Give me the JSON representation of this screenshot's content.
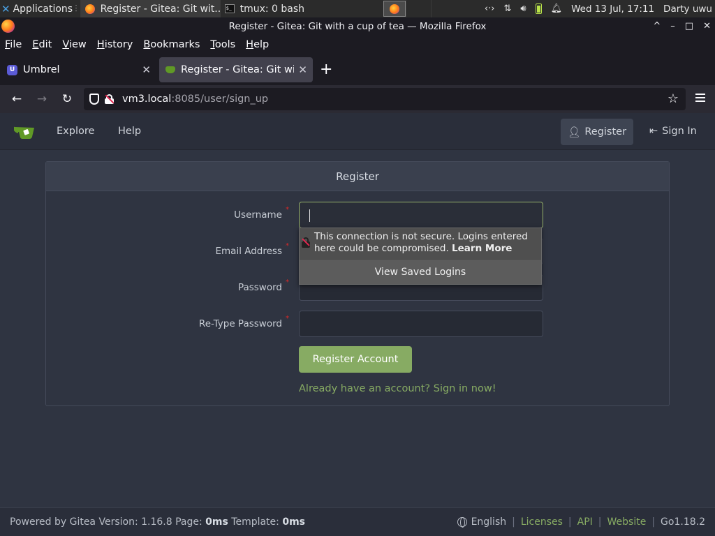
{
  "panel": {
    "applications_label": "Applications",
    "tasks": [
      {
        "label": "Register - Gitea: Git wit..."
      },
      {
        "label": "tmux: 0 bash"
      }
    ],
    "datetime": "Wed 13 Jul, 17:11",
    "user": "Darty uwu"
  },
  "window": {
    "title": "Register - Gitea: Git with a cup of tea — Mozilla Firefox",
    "controls": {
      "max": "^",
      "min": "–",
      "restore": "□",
      "close": "✕"
    }
  },
  "menubar": [
    "File",
    "Edit",
    "View",
    "History",
    "Bookmarks",
    "Tools",
    "Help"
  ],
  "tabs": [
    {
      "title": "Umbrel",
      "favicon": "umbrel-icon"
    },
    {
      "title": "Register - Gitea: Git with a cup of tea",
      "favicon": "gitea-icon",
      "selected": true
    }
  ],
  "urlbar": {
    "host": "vm3.local",
    "rest": ":8085/user/sign_up"
  },
  "gitea": {
    "nav": {
      "explore": "Explore",
      "help": "Help",
      "register": "Register",
      "sign_in": "Sign In"
    },
    "form": {
      "header": "Register",
      "fields": [
        {
          "label": "Username",
          "value": ""
        },
        {
          "label": "Email Address",
          "value": ""
        },
        {
          "label": "Password",
          "value": ""
        },
        {
          "label": "Re-Type Password",
          "value": ""
        }
      ],
      "submit": "Register Account",
      "signin_link": "Already have an account? Sign in now!"
    },
    "popup": {
      "message": "This connection is not secure. Logins entered here could be compromised.",
      "learn_more": "Learn More",
      "saved_logins": "View Saved Logins"
    },
    "footer": {
      "powered_prefix": "Powered by Gitea Version: 1.16.8 Page: ",
      "page_time": "0ms",
      "template_prefix": " Template: ",
      "template_time": "0ms",
      "language": "English",
      "licenses": "Licenses",
      "api": "API",
      "website": "Website",
      "go_version": "Go1.18.2"
    }
  },
  "colors": {
    "accent_green": "#87ab63",
    "required_red": "#db2828",
    "gitea_logo": "#609926"
  }
}
